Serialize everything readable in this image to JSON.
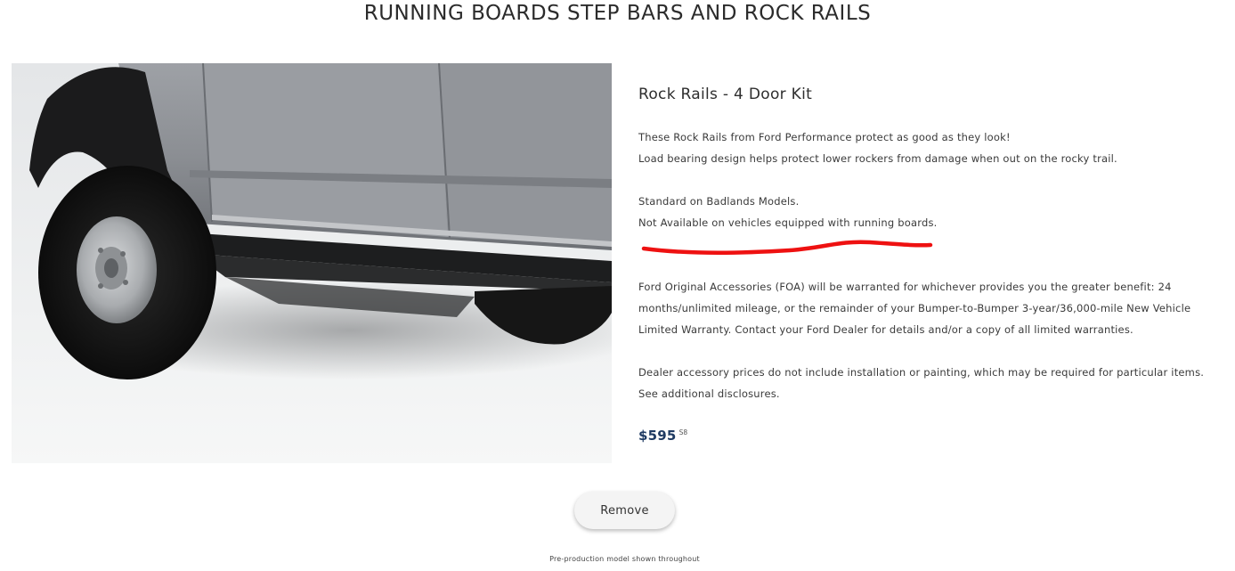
{
  "header": {
    "title": "RUNNING BOARDS STEP BARS AND ROCK RAILS"
  },
  "product": {
    "image_icon": "vehicle-rock-rails-image",
    "name": "Rock Rails - 4 Door Kit",
    "description_lines": [
      "These Rock Rails from Ford Performance protect as good as they look!",
      "Load bearing design helps protect lower rockers from damage when out on the rocky trail."
    ],
    "availability_lines": [
      "Standard on Badlands Models.",
      "Not Available on vehicles equipped with running boards."
    ],
    "warranty_text": "Ford Original Accessories (FOA) will be warranted for whichever provides you the greater benefit: 24 months/unlimited mileage, or the remainder of your Bumper-to-Bumper 3-year/36,000-mile New Vehicle Limited Warranty. Contact your Ford Dealer for details and/or a copy of all limited warranties.",
    "disclosure_text": "Dealer accessory prices do not include installation or painting, which may be required for particular items. See additional disclosures.",
    "price": "$595",
    "price_note": "S8"
  },
  "actions": {
    "remove_label": "Remove"
  },
  "footer": {
    "note": "Pre-production model shown throughout"
  },
  "colors": {
    "price": "#1f3b63",
    "annotation": "#ee1111",
    "button_bg": "#f4f4f4"
  }
}
